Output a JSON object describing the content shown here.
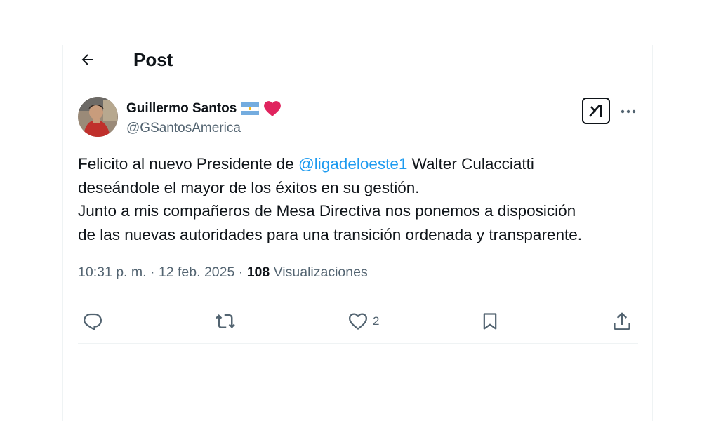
{
  "header": {
    "title": "Post",
    "back_icon": "arrow-left-icon"
  },
  "author": {
    "display_name": "Guillermo Santos",
    "handle": "@GSantosAmerica",
    "badges": [
      "argentina-flag-icon",
      "red-heart-icon"
    ]
  },
  "post": {
    "line1_before": "Felicito al nuevo Presidente de ",
    "line1_mention": "@ligadeloeste1",
    "line1_after": " Walter Culacciatti",
    "line2": "deseándole el mayor de los éxitos en su gestión.",
    "line3": "Junto a mis compañeros de Mesa Directiva nos ponemos a disposición",
    "line4": "de las nuevas autoridades para una transición ordenada y transparente."
  },
  "meta": {
    "time": "10:31 p. m.",
    "separator": " · ",
    "date": "12 feb. 2025",
    "views_count": "108",
    "views_label": "Visualizaciones"
  },
  "actions": {
    "reply_count": "",
    "repost_count": "",
    "like_count": "2",
    "bookmark_count": "",
    "share_count": ""
  },
  "colors": {
    "text": "#0f1419",
    "secondary": "#536471",
    "link": "#1d9bf0",
    "border": "#eff3f4",
    "heart": "#e0245e"
  }
}
